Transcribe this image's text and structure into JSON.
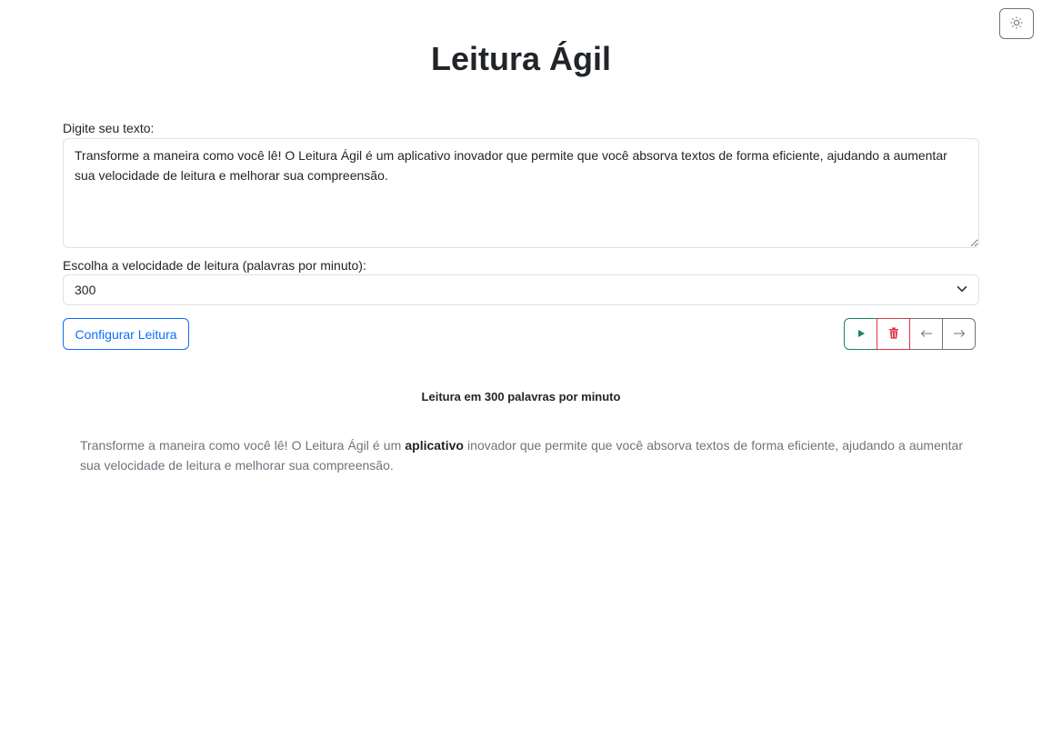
{
  "header": {
    "title": "Leitura Ágil",
    "theme_toggle_icon": "sun-icon"
  },
  "form": {
    "text_label": "Digite seu texto:",
    "text_value": "Transforme a maneira como você lê! O Leitura Ágil é um aplicativo inovador que permite que você absorva textos de forma eficiente, ajudando a aumentar sua velocidade de leitura e melhorar sua compreensão.",
    "speed_label": "Escolha a velocidade de leitura (palavras por minuto):",
    "speed_value": "300",
    "configure_button": "Configurar Leitura"
  },
  "controls": {
    "play_icon": "play-icon",
    "play_color": "#198754",
    "delete_icon": "trash-icon",
    "delete_color": "#dc3545",
    "prev_icon": "arrow-left-icon",
    "next_icon": "arrow-right-icon"
  },
  "reader": {
    "status": "Leitura em 300 palavras por minuto",
    "before": "Transforme a maneira como você lê! O Leitura Ágil é um ",
    "current_word": "aplicativo",
    "after": " inovador que permite que você absorva textos de forma eficiente, ajudando a aumentar sua velocidade de leitura e melhorar sua compreensão."
  }
}
